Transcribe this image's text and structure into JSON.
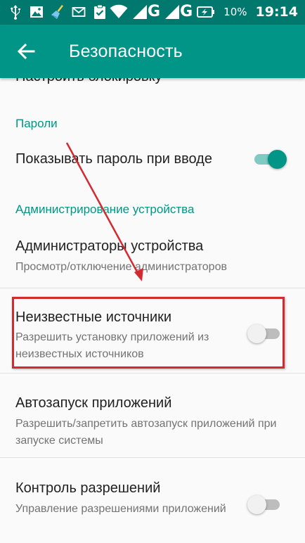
{
  "status_bar": {
    "network_1": "G",
    "network_2": "G",
    "battery_percent": "10%",
    "time": "19:14",
    "icons": [
      "usb-icon",
      "image-icon",
      "broom-icon",
      "mail-icon",
      "clipboard-check-icon",
      "wifi-icon",
      "signal-icon",
      "battery-charging-icon"
    ]
  },
  "app_bar": {
    "title": "Безопасность",
    "back_icon": "arrow-left-icon"
  },
  "settings": {
    "cut_off_item": "Настроить блокировку",
    "passwords_header": "Пароли",
    "show_password": {
      "title": "Показывать пароль при вводе",
      "enabled": true
    },
    "device_admin_header": "Администрирование устройства",
    "device_admins": {
      "title": "Администраторы устройства",
      "summary": "Просмотр/отключение администраторов"
    },
    "unknown_sources": {
      "title": "Неизвестные источники",
      "summary": "Разрешить установку приложений из неизвестных источников",
      "enabled": false
    },
    "autostart": {
      "title": "Автозапуск приложений",
      "summary": "Разрешить/запретить автозапуск приложений при запуске системы"
    },
    "permission_control": {
      "title": "Контроль разрешений",
      "summary": "Управление разрешениями приложений",
      "enabled": false
    }
  },
  "colors": {
    "status_bar": "#00786d",
    "app_bar": "#009587",
    "accent": "#009587",
    "annotation_red": "#d32a2f"
  }
}
